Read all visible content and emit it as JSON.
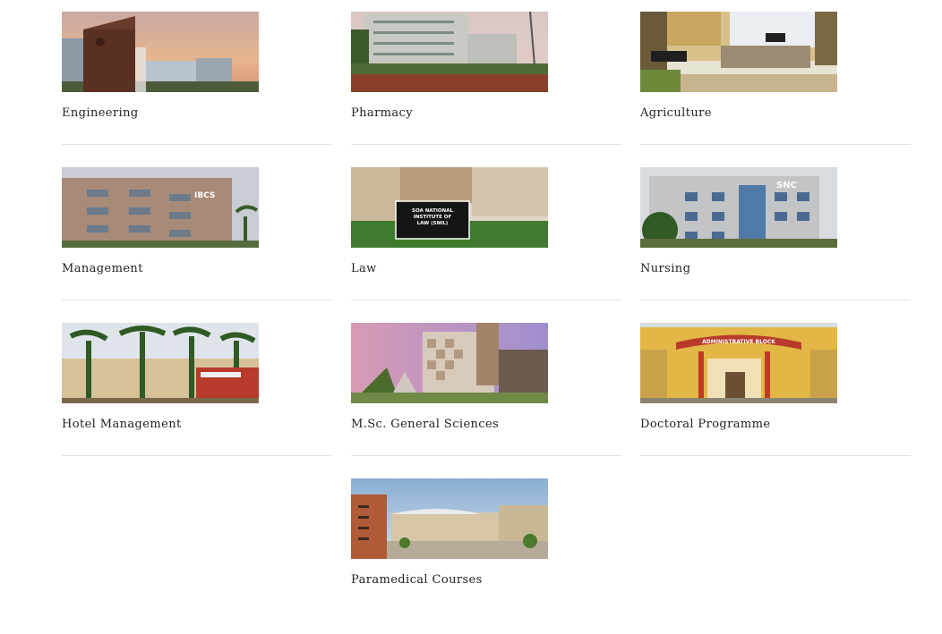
{
  "programs": [
    {
      "label": "Engineering",
      "image": "engineering-campus-photo"
    },
    {
      "label": "Pharmacy",
      "image": "pharmacy-building-photo"
    },
    {
      "label": "Agriculture",
      "image": "agriculture-gate-photo"
    },
    {
      "label": "Management",
      "image": "management-building-photo"
    },
    {
      "label": "Law",
      "image": "law-institute-photo"
    },
    {
      "label": "Nursing",
      "image": "nursing-college-photo"
    },
    {
      "label": "Hotel Management",
      "image": "hotel-management-photo"
    },
    {
      "label": "M.Sc. General Sciences",
      "image": "general-sciences-photo"
    },
    {
      "label": "Doctoral Programme",
      "image": "administrative-block-photo"
    },
    {
      "label": "Paramedical Courses",
      "image": "paramedical-campus-photo"
    }
  ],
  "photo_signage": {
    "management": "IBCS",
    "law": [
      "SOA NATIONAL",
      "INSTITUTE OF",
      "LAW (SNIL)"
    ],
    "nursing": "SNC",
    "doctoral": "ADMINISTRATIVE BLOCK"
  }
}
